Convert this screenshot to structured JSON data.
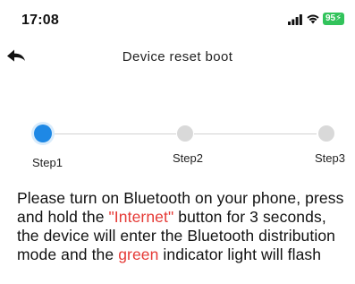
{
  "status_bar": {
    "time": "17:08",
    "battery_text": "95",
    "battery_color": "#32c35b",
    "icons": [
      "signal-icon",
      "wifi-icon",
      "battery-icon"
    ]
  },
  "header": {
    "title": "Device reset boot",
    "back_icon": "back-arrow-icon"
  },
  "stepper": {
    "active_color": "#1e88e5",
    "inactive_color": "#d9d9d9",
    "current_step": 1,
    "steps": [
      {
        "label": "Step1"
      },
      {
        "label": "Step2"
      },
      {
        "label": "Step3"
      }
    ]
  },
  "instructions": {
    "highlight_color": "#e53935",
    "part1": "Please turn on Bluetooth on your phone, press and hold the ",
    "button_name": "\"Internet\"",
    "part2": " button for 3 seconds, the device will enter the Bluetooth distribution mode and the ",
    "color_word": "green",
    "part3": " indicator light will flash"
  }
}
